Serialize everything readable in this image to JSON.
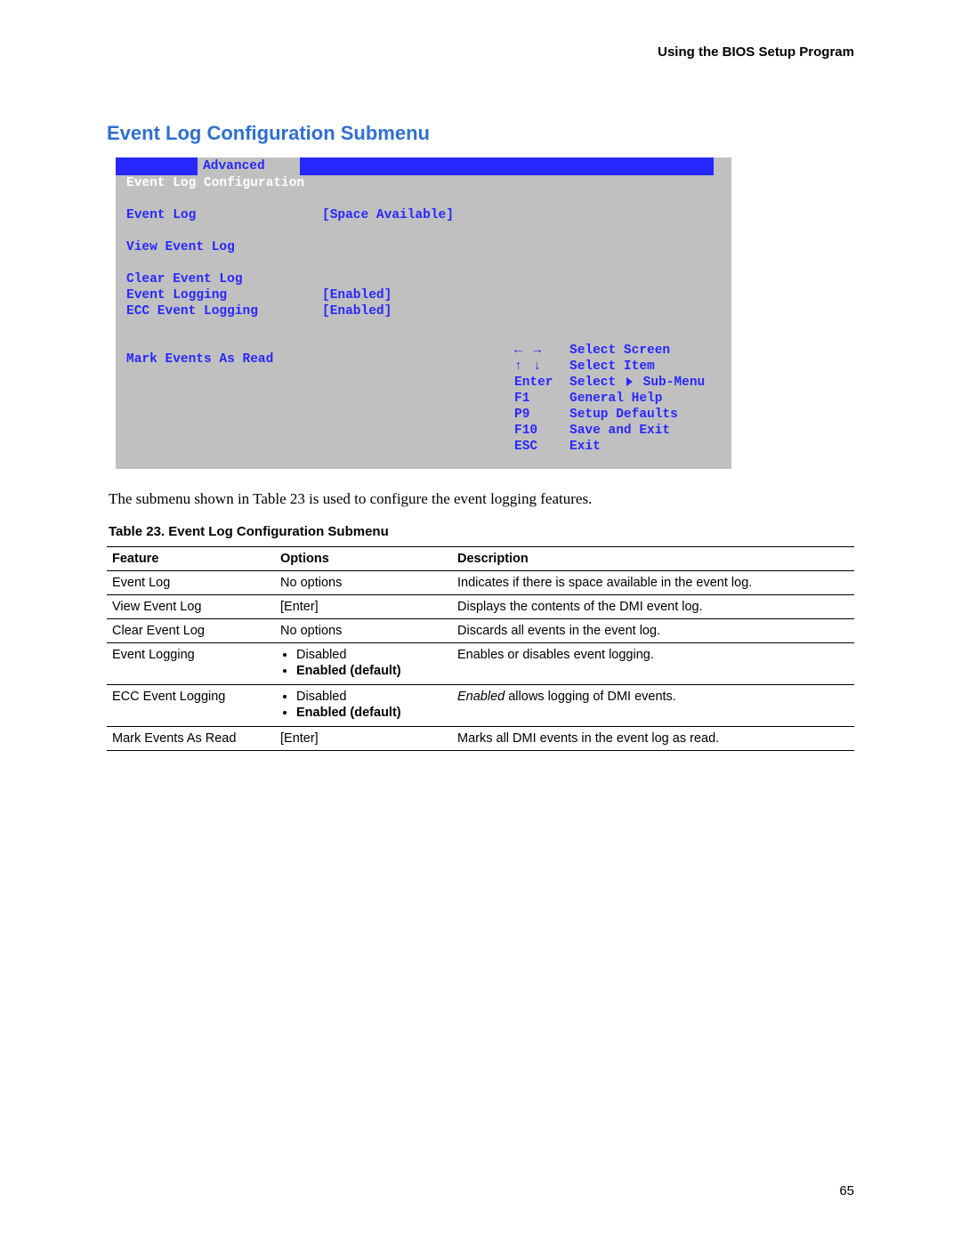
{
  "header": {
    "right": "Using the BIOS Setup Program"
  },
  "section_title": "Event Log Configuration Submenu",
  "bios": {
    "menubar_tab": "Advanced",
    "submenu_title": "Event Log Configuration",
    "rows": [
      {
        "label": "Event Log",
        "value": "[Space Available]"
      },
      {
        "label": "",
        "value": ""
      },
      {
        "label": "View Event Log",
        "value": ""
      },
      {
        "label": "",
        "value": ""
      },
      {
        "label": "Clear Event Log",
        "value": ""
      },
      {
        "label": "Event Logging",
        "value": "[Enabled]"
      },
      {
        "label": "ECC Event Logging",
        "value": "[Enabled]"
      },
      {
        "label": "",
        "value": ""
      },
      {
        "label": "",
        "value": ""
      },
      {
        "label": "Mark Events As Read",
        "value": ""
      }
    ],
    "help": [
      {
        "key": "← →",
        "text": "Select Screen"
      },
      {
        "key": "↑ ↓",
        "text": "Select Item"
      },
      {
        "key": "Enter",
        "text": "Select ▸ Sub-Menu"
      },
      {
        "key": "F1",
        "text": "General Help"
      },
      {
        "key": "P9",
        "text": "Setup Defaults"
      },
      {
        "key": "F10",
        "text": "Save and Exit"
      },
      {
        "key": "ESC",
        "text": "Exit"
      }
    ]
  },
  "intro": "The submenu shown in Table 23 is used to configure the event logging features.",
  "table_caption": "Table 23.    Event Log Configuration Submenu",
  "table": {
    "head": [
      "Feature",
      "Options",
      "Description"
    ],
    "rows": [
      {
        "feature": "Event Log",
        "options_text": "No options",
        "description": "Indicates if there is space available in the event log."
      },
      {
        "feature": "View Event Log",
        "options_text": "[Enter]",
        "description": "Displays the contents of the DMI event log."
      },
      {
        "feature": "Clear Event Log",
        "options_text": "No options",
        "description": "Discards all events in the event log."
      },
      {
        "feature": "Event Logging",
        "options_list": [
          "Disabled",
          "Enabled (default)"
        ],
        "default_index": 1,
        "description": "Enables or disables event logging."
      },
      {
        "feature": "ECC Event Logging",
        "options_list": [
          "Disabled",
          "Enabled (default)"
        ],
        "default_index": 1,
        "description_html": "<span class='italic'>Enabled</span> allows logging of DMI events."
      },
      {
        "feature": "Mark Events As Read",
        "options_text": "[Enter]",
        "description": "Marks all DMI events in the event log as read."
      }
    ]
  },
  "page_number": "65"
}
